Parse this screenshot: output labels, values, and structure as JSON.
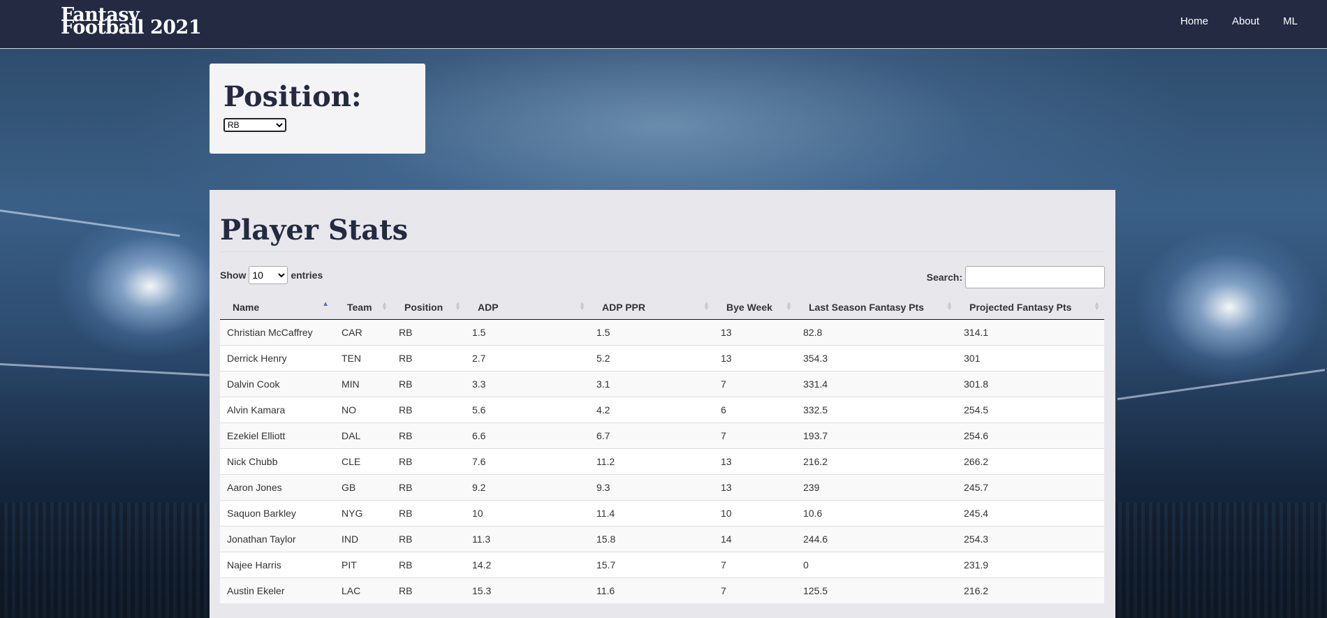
{
  "navbar": {
    "brand_line1": "Fantasy",
    "brand_line2": "Football 2021",
    "links": [
      "Home",
      "About",
      "ML"
    ]
  },
  "position_filter": {
    "title": "Position:",
    "selected": "RB"
  },
  "stats": {
    "title": "Player Stats",
    "show_label": "Show",
    "entries_value": "10",
    "entries_label": "entries",
    "search_label": "Search:",
    "columns": [
      "Name",
      "Team",
      "Position",
      "ADP",
      "ADP PPR",
      "Bye Week",
      "Last Season Fantasy Pts",
      "Projected Fantasy Pts"
    ],
    "rows": [
      [
        "Christian McCaffrey",
        "CAR",
        "RB",
        "1.5",
        "1.5",
        "13",
        "82.8",
        "314.1"
      ],
      [
        "Derrick Henry",
        "TEN",
        "RB",
        "2.7",
        "5.2",
        "13",
        "354.3",
        "301"
      ],
      [
        "Dalvin Cook",
        "MIN",
        "RB",
        "3.3",
        "3.1",
        "7",
        "331.4",
        "301.8"
      ],
      [
        "Alvin Kamara",
        "NO",
        "RB",
        "5.6",
        "4.2",
        "6",
        "332.5",
        "254.5"
      ],
      [
        "Ezekiel Elliott",
        "DAL",
        "RB",
        "6.6",
        "6.7",
        "7",
        "193.7",
        "254.6"
      ],
      [
        "Nick Chubb",
        "CLE",
        "RB",
        "7.6",
        "11.2",
        "13",
        "216.2",
        "266.2"
      ],
      [
        "Aaron Jones",
        "GB",
        "RB",
        "9.2",
        "9.3",
        "13",
        "239",
        "245.7"
      ],
      [
        "Saquon Barkley",
        "NYG",
        "RB",
        "10",
        "11.4",
        "10",
        "10.6",
        "245.4"
      ],
      [
        "Jonathan Taylor",
        "IND",
        "RB",
        "11.3",
        "15.8",
        "14",
        "244.6",
        "254.3"
      ],
      [
        "Najee Harris",
        "PIT",
        "RB",
        "14.2",
        "15.7",
        "7",
        "0",
        "231.9"
      ],
      [
        "Austin Ekeler",
        "LAC",
        "RB",
        "15.3",
        "11.6",
        "7",
        "125.5",
        "216.2"
      ]
    ]
  },
  "colors": {
    "navbar": "#232a42",
    "heading": "#232a42",
    "sort_active": "#5a6adc"
  }
}
